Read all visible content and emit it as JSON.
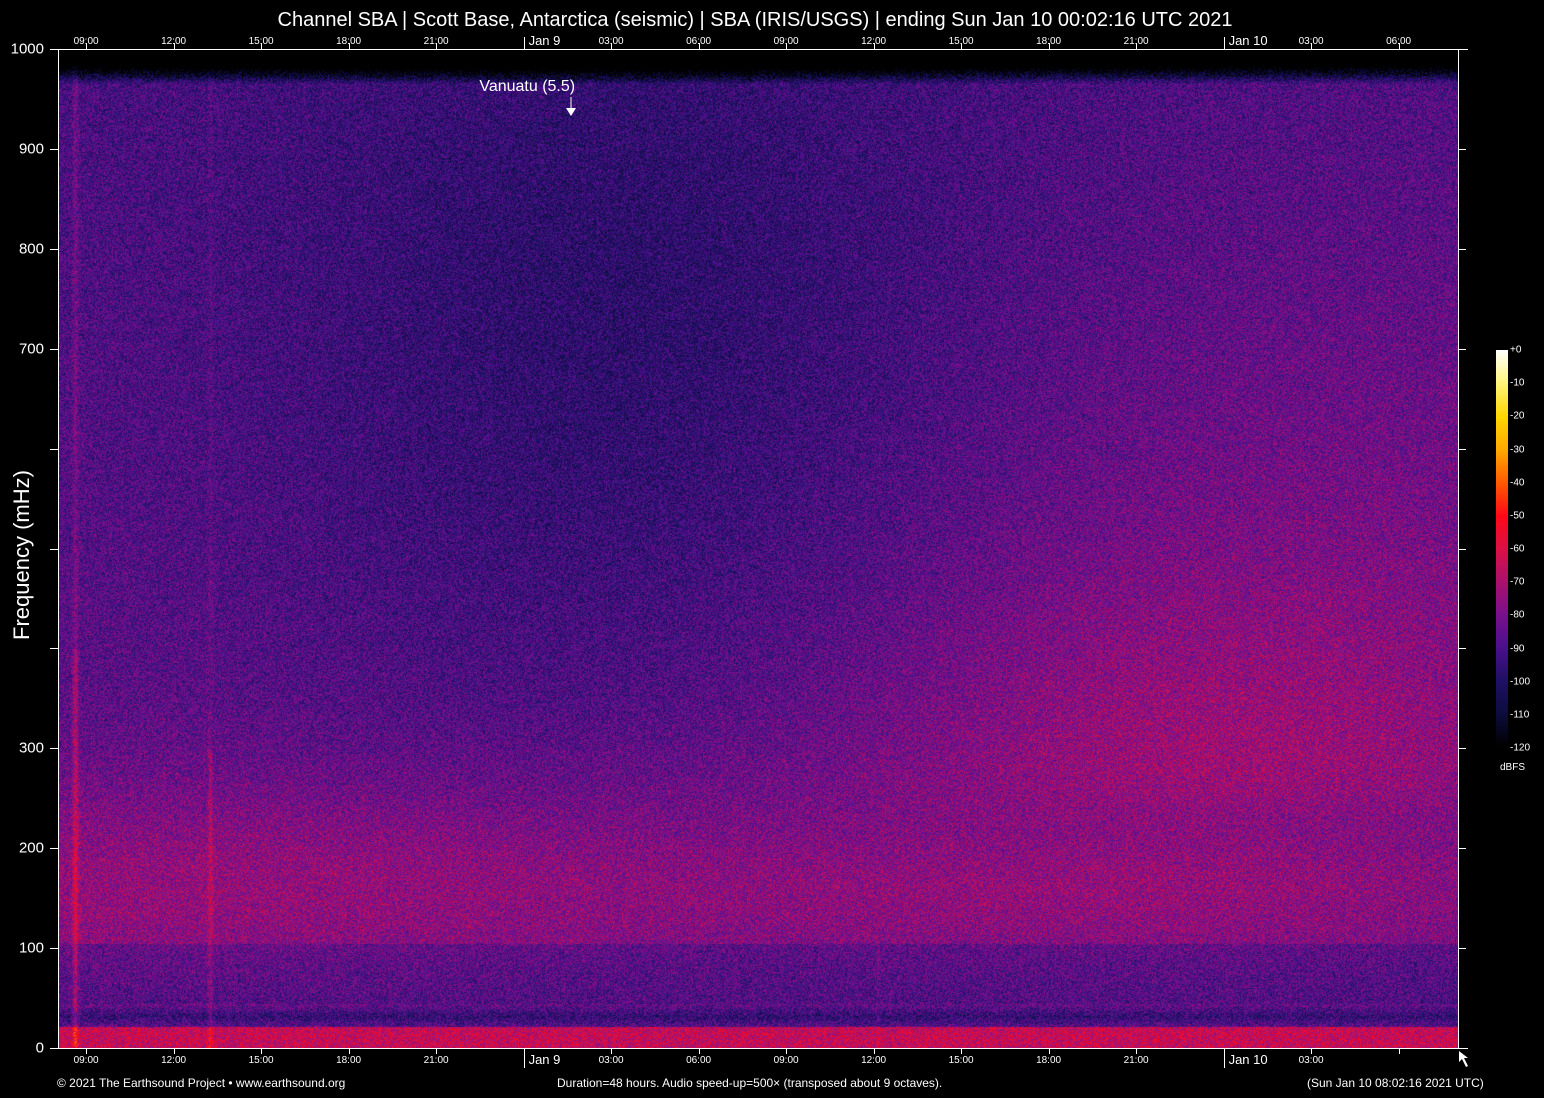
{
  "title": "Channel SBA | Scott Base, Antarctica (seismic) | SBA (IRIS/USGS) | ending Sun Jan 10 00:02:16 UTC 2021",
  "footer": {
    "copyright": "© 2021 The Earthsound Project • www.earthsound.org",
    "duration": "Duration=48 hours. Audio speed-up=500× (transposed about 9 octaves).",
    "timestamp": "(Sun Jan 10 08:02:16 2021 UTC)"
  },
  "chart_data": {
    "type": "heatmap",
    "title": "Channel SBA | Scott Base, Antarctica (seismic) | SBA (IRIS/USGS) | ending Sun Jan 10 00:02:16 UTC 2021",
    "xlabel": "",
    "ylabel": "Frequency (mHz)",
    "duration_hours": 48,
    "xlim_hours": [
      0,
      48
    ],
    "ylim": [
      0,
      1000
    ],
    "x_ticks_top": [
      {
        "label": "09:00",
        "hour": 0.963
      },
      {
        "label": "12:00",
        "hour": 3.963
      },
      {
        "label": "15:00",
        "hour": 6.963
      },
      {
        "label": "18:00",
        "hour": 9.963
      },
      {
        "label": "21:00",
        "hour": 12.963
      },
      {
        "label": "Jan  9",
        "hour": 15.963,
        "day": true
      },
      {
        "label": "03:00",
        "hour": 18.963
      },
      {
        "label": "06:00",
        "hour": 21.963
      },
      {
        "label": "09:00",
        "hour": 24.963
      },
      {
        "label": "12:00",
        "hour": 27.963
      },
      {
        "label": "15:00",
        "hour": 30.963
      },
      {
        "label": "18:00",
        "hour": 33.963
      },
      {
        "label": "21:00",
        "hour": 36.963
      },
      {
        "label": "Jan 10",
        "hour": 39.963,
        "day": true
      },
      {
        "label": "03:00",
        "hour": 42.963
      },
      {
        "label": "06:00",
        "hour": 45.963
      }
    ],
    "x_ticks_bottom": [
      {
        "label": "09:00",
        "hour": 0.963
      },
      {
        "label": "12:00",
        "hour": 3.963
      },
      {
        "label": "15:00",
        "hour": 6.963
      },
      {
        "label": "18:00",
        "hour": 9.963
      },
      {
        "label": "21:00",
        "hour": 12.963
      },
      {
        "label": "Jan  9",
        "hour": 15.963,
        "day": true
      },
      {
        "label": "03:00",
        "hour": 18.963
      },
      {
        "label": "06:00",
        "hour": 21.963
      },
      {
        "label": "09:00",
        "hour": 24.963
      },
      {
        "label": "12:00",
        "hour": 27.963
      },
      {
        "label": "15:00",
        "hour": 30.963
      },
      {
        "label": "18:00",
        "hour": 33.963
      },
      {
        "label": "21:00",
        "hour": 36.963
      },
      {
        "label": "Jan 10",
        "hour": 39.963,
        "day": true
      },
      {
        "label": "03:00",
        "hour": 42.963
      },
      {
        "label": "",
        "hour": 45.963
      }
    ],
    "y_ticks": [
      {
        "value": 0,
        "label": "0"
      },
      {
        "value": 100,
        "label": "100"
      },
      {
        "value": 200,
        "label": "200"
      },
      {
        "value": 300,
        "label": "300"
      },
      {
        "value": 400,
        "label": ""
      },
      {
        "value": 500,
        "label": ""
      },
      {
        "value": 600,
        "label": ""
      },
      {
        "value": 700,
        "label": "700"
      },
      {
        "value": 800,
        "label": "800"
      },
      {
        "value": 900,
        "label": "900"
      },
      {
        "value": 1000,
        "label": "1000"
      }
    ],
    "colorbar": {
      "unit": "dBFS",
      "range": [
        -120,
        0
      ],
      "ticks": [
        "+0",
        "-10",
        "-20",
        "-30",
        "-40",
        "-50",
        "-60",
        "-70",
        "-80",
        "-90",
        "-100",
        "-110",
        "-120"
      ],
      "colormap": [
        "#000000",
        "#10104a",
        "#4a108a",
        "#a0107a",
        "#e0104a",
        "#ff1010",
        "#ff7a00",
        "#ffd000",
        "#ffffff"
      ]
    },
    "annotations": [
      {
        "label": "Vanuatu (5.5)",
        "hour": 17.6
      }
    ]
  }
}
